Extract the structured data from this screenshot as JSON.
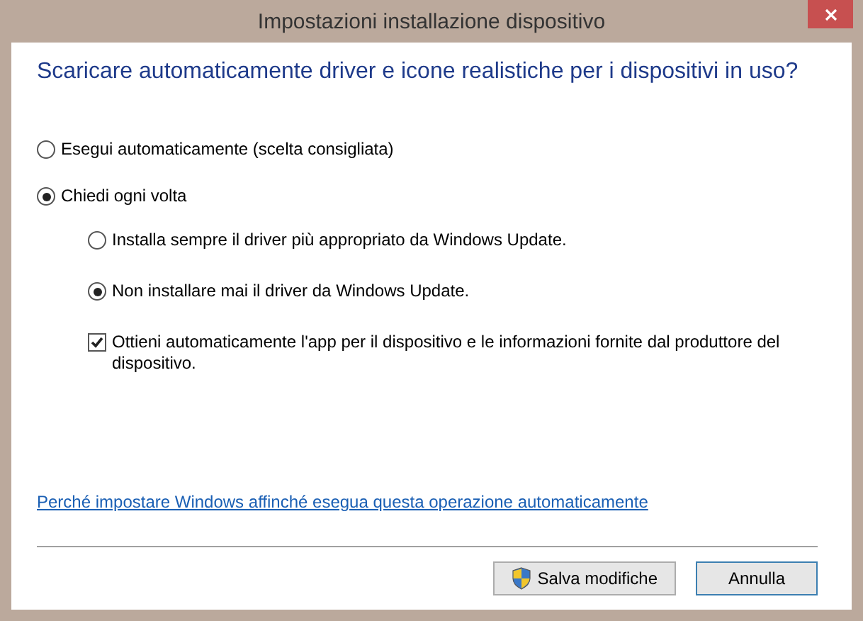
{
  "window": {
    "title": "Impostazioni installazione dispositivo"
  },
  "heading": "Scaricare automaticamente driver e icone realistiche per i dispositivi in uso?",
  "options": [
    {
      "kind": "radio",
      "label": "Esegui automaticamente (scelta consigliata)",
      "selected": false
    },
    {
      "kind": "radio",
      "label": "Chiedi ogni volta",
      "selected": true,
      "children": [
        {
          "kind": "radio",
          "label": "Installa sempre il driver più appropriato da Windows Update.",
          "selected": false
        },
        {
          "kind": "radio",
          "label": "Non installare mai il driver da Windows Update.",
          "selected": true
        },
        {
          "kind": "checkbox",
          "label": "Ottieni automaticamente l'app per il dispositivo e le informazioni fornite dal produttore del dispositivo.",
          "checked": true
        }
      ]
    }
  ],
  "link": "Perché impostare Windows affinché esegua questa operazione automaticamente",
  "buttons": [
    {
      "kind": "elevated",
      "label": "Salva modifiche",
      "default": false
    },
    {
      "kind": "plain",
      "label": "Annulla",
      "default": true
    }
  ]
}
